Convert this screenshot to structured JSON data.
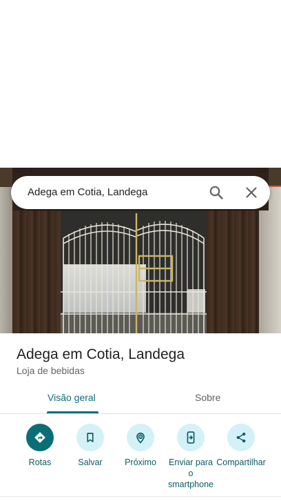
{
  "search": {
    "query": "Adega em Cotia, Landega",
    "search_icon": "search-icon",
    "clear_icon": "close-icon"
  },
  "photo": {
    "description_icon": "storefront-photo"
  },
  "place": {
    "name": "Adega em Cotia, Landega",
    "category": "Loja de bebidas"
  },
  "tabs": [
    {
      "label": "Visão geral",
      "selected": true
    },
    {
      "label": "Sobre",
      "selected": false
    }
  ],
  "actions": [
    {
      "label": "Rotas",
      "icon": "directions-icon"
    },
    {
      "label": "Salvar",
      "icon": "bookmark-icon"
    },
    {
      "label": "Próximo",
      "icon": "nearby-icon"
    },
    {
      "label": "Enviar para o smartphone",
      "icon": "send-to-phone-icon"
    },
    {
      "label": "Compartilhar",
      "icon": "share-icon"
    }
  ],
  "colors": {
    "accent": "#0b6e77",
    "action_bg": "#d3f1f7",
    "text_primary": "#202124",
    "text_secondary": "#5f6368"
  }
}
